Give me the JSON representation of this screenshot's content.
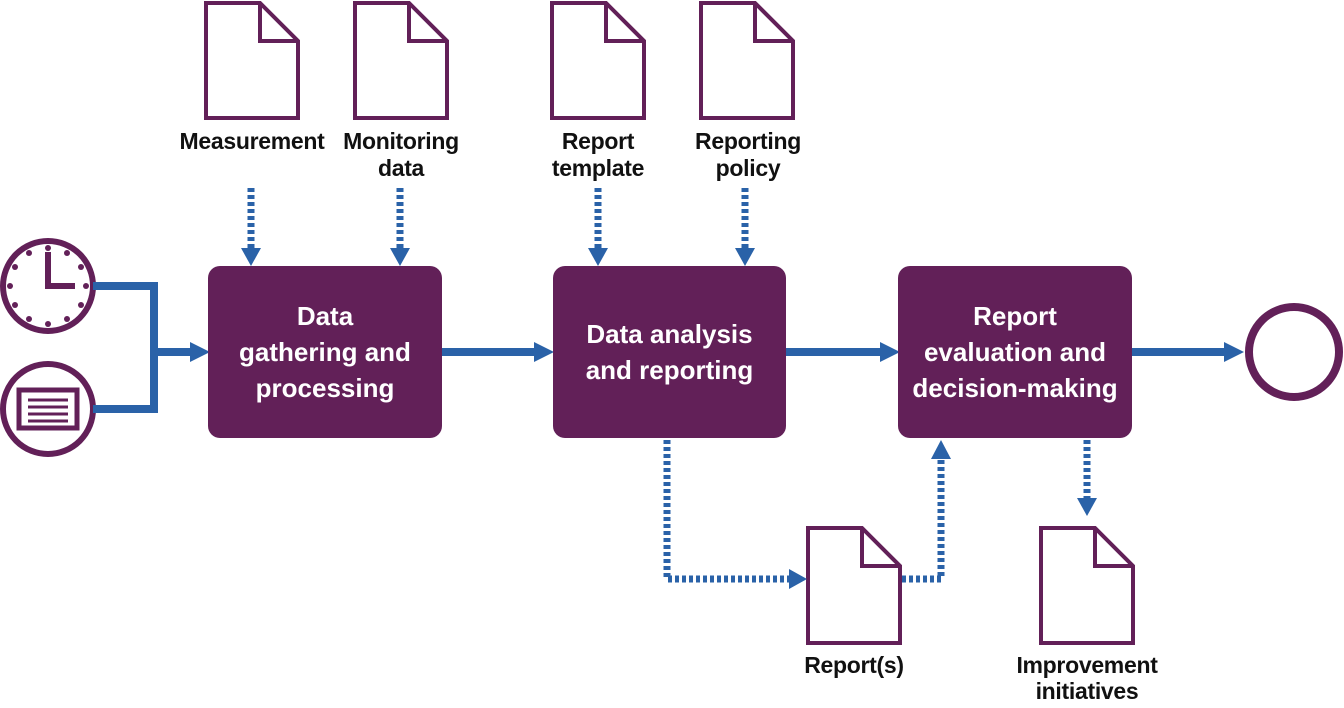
{
  "colors": {
    "purple": "#622058",
    "blue": "#2a62a8",
    "white": "#ffffff"
  },
  "inputs": {
    "measurement": "Measurement",
    "monitoring_data": "Monitoring\ndata",
    "report_template": "Report\ntemplate",
    "reporting_policy": "Reporting\npolicy"
  },
  "process": {
    "step1": "Data\ngathering and\nprocessing",
    "step2": "Data analysis\nand reporting",
    "step3": "Report\nevaluation and\ndecision-making"
  },
  "outputs": {
    "reports": "Report(s)",
    "improvement": "Improvement\ninitiatives"
  },
  "events": {
    "start_timer": "clock-icon",
    "start_message": "message-icon",
    "end": "end-event-circle"
  }
}
